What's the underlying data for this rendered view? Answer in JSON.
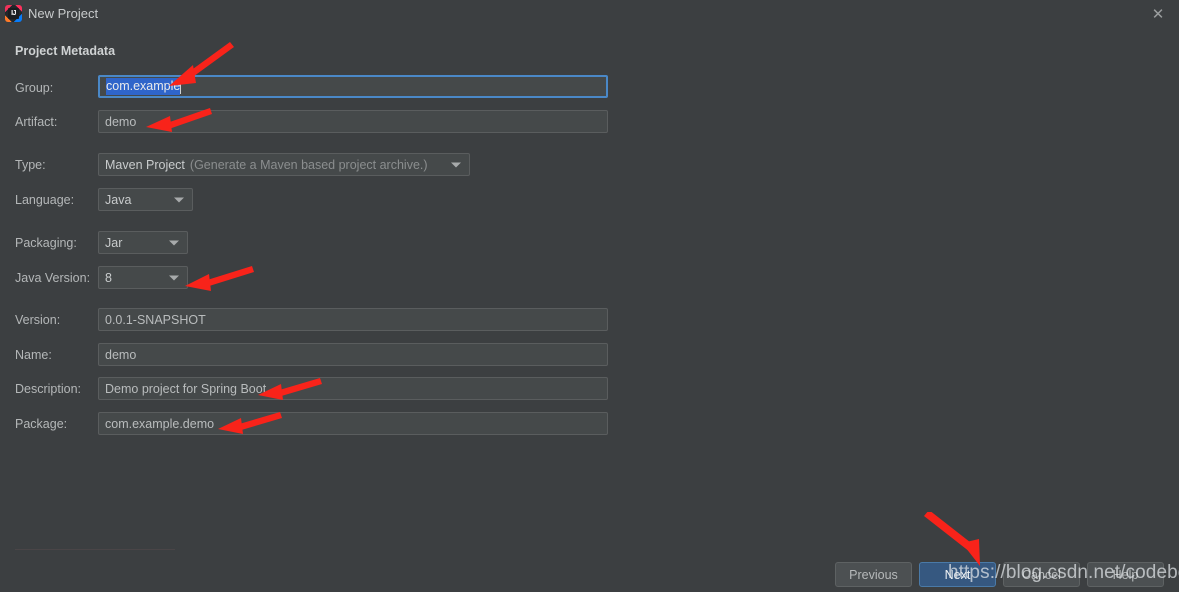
{
  "window": {
    "title": "New Project",
    "app_icon": "intellij-idea-icon",
    "close_icon": "close-icon"
  },
  "section": {
    "heading": "Project Metadata"
  },
  "fields": [
    {
      "key": "group",
      "label": "Group:",
      "value": "com.example",
      "control": "text",
      "focused": true,
      "selected": true
    },
    {
      "key": "artifact",
      "label": "Artifact:",
      "value": "demo",
      "control": "text",
      "focused": false,
      "selected": false
    },
    {
      "key": "type",
      "label": "Type:",
      "value": "Maven Project",
      "hint": "(Generate a Maven based project archive.)",
      "control": "combo"
    },
    {
      "key": "language",
      "label": "Language:",
      "value": "Java",
      "control": "combo"
    },
    {
      "key": "packaging",
      "label": "Packaging:",
      "value": "Jar",
      "control": "combo"
    },
    {
      "key": "javaversion",
      "label": "Java Version:",
      "value": "8",
      "control": "combo"
    },
    {
      "key": "version",
      "label": "Version:",
      "value": "0.0.1-SNAPSHOT",
      "control": "text"
    },
    {
      "key": "name",
      "label": "Name:",
      "value": "demo",
      "control": "text"
    },
    {
      "key": "description",
      "label": "Description:",
      "value": "Demo project for Spring Boot",
      "control": "text"
    },
    {
      "key": "package",
      "label": "Package:",
      "value": "com.example.demo",
      "control": "text"
    }
  ],
  "buttons": {
    "previous": "Previous",
    "next": "Next",
    "cancel": "Cancel",
    "help": "Help"
  },
  "watermark": {
    "text": "https://blog.csdn.net/codebeef"
  },
  "annotations": {
    "color": "#f8231a",
    "arrows": [
      {
        "name": "arrow-to-group-field",
        "points_to": "group"
      },
      {
        "name": "arrow-to-artifact-field",
        "points_to": "artifact"
      },
      {
        "name": "arrow-to-java-version",
        "points_to": "javaversion"
      },
      {
        "name": "arrow-to-description",
        "points_to": "description"
      },
      {
        "name": "arrow-to-package",
        "points_to": "package"
      },
      {
        "name": "arrow-to-next-button",
        "points_to": "next"
      }
    ]
  }
}
